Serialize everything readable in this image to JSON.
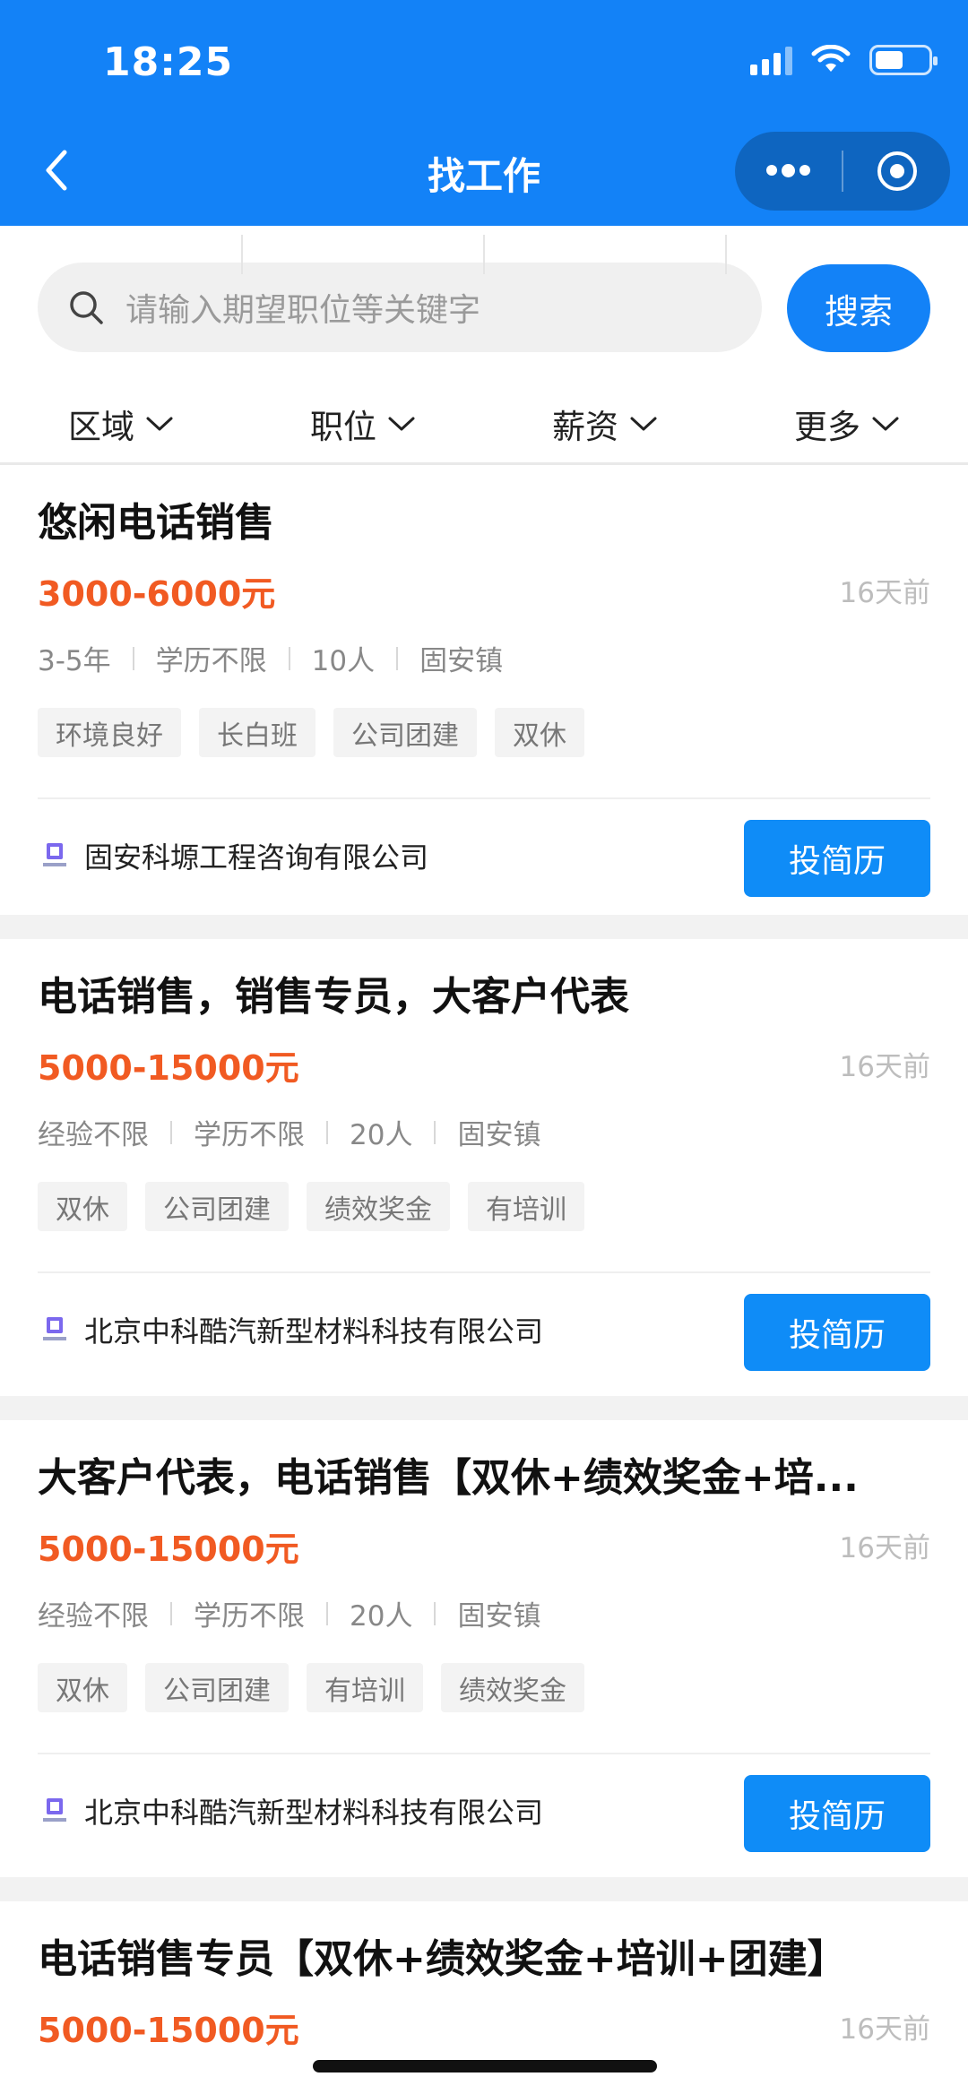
{
  "status_bar": {
    "time": "18:25"
  },
  "nav": {
    "title": "找工作"
  },
  "search": {
    "placeholder": "请输入期望职位等关键字",
    "button_label": "搜索"
  },
  "filters": [
    "区域",
    "职位",
    "薪资",
    "更多"
  ],
  "jobs": [
    {
      "title": "悠闲电话销售",
      "salary": "3000-6000元",
      "posted": "16天前",
      "meta": [
        "3-5年",
        "学历不限",
        "10人",
        "固安镇"
      ],
      "tags": [
        "环境良好",
        "长白班",
        "公司团建",
        "双休"
      ],
      "company": "固安科塬工程咨询有限公司",
      "apply_label": "投简历"
    },
    {
      "title": "电话销售，销售专员，大客户代表",
      "salary": "5000-15000元",
      "posted": "16天前",
      "meta": [
        "经验不限",
        "学历不限",
        "20人",
        "固安镇"
      ],
      "tags": [
        "双休",
        "公司团建",
        "绩效奖金",
        "有培训"
      ],
      "company": "北京中科酷汽新型材料科技有限公司",
      "apply_label": "投简历"
    },
    {
      "title": "大客户代表，电话销售【双休+绩效奖金+培...",
      "salary": "5000-15000元",
      "posted": "16天前",
      "meta": [
        "经验不限",
        "学历不限",
        "20人",
        "固安镇"
      ],
      "tags": [
        "双休",
        "公司团建",
        "有培训",
        "绩效奖金"
      ],
      "company": "北京中科酷汽新型材料科技有限公司",
      "apply_label": "投简历"
    },
    {
      "title": "电话销售专员【双休+绩效奖金+培训+团建】",
      "salary": "5000-15000元",
      "posted": "16天前"
    }
  ],
  "colors": {
    "brand_blue": "#1382f7",
    "salary_orange": "#f15a22"
  }
}
